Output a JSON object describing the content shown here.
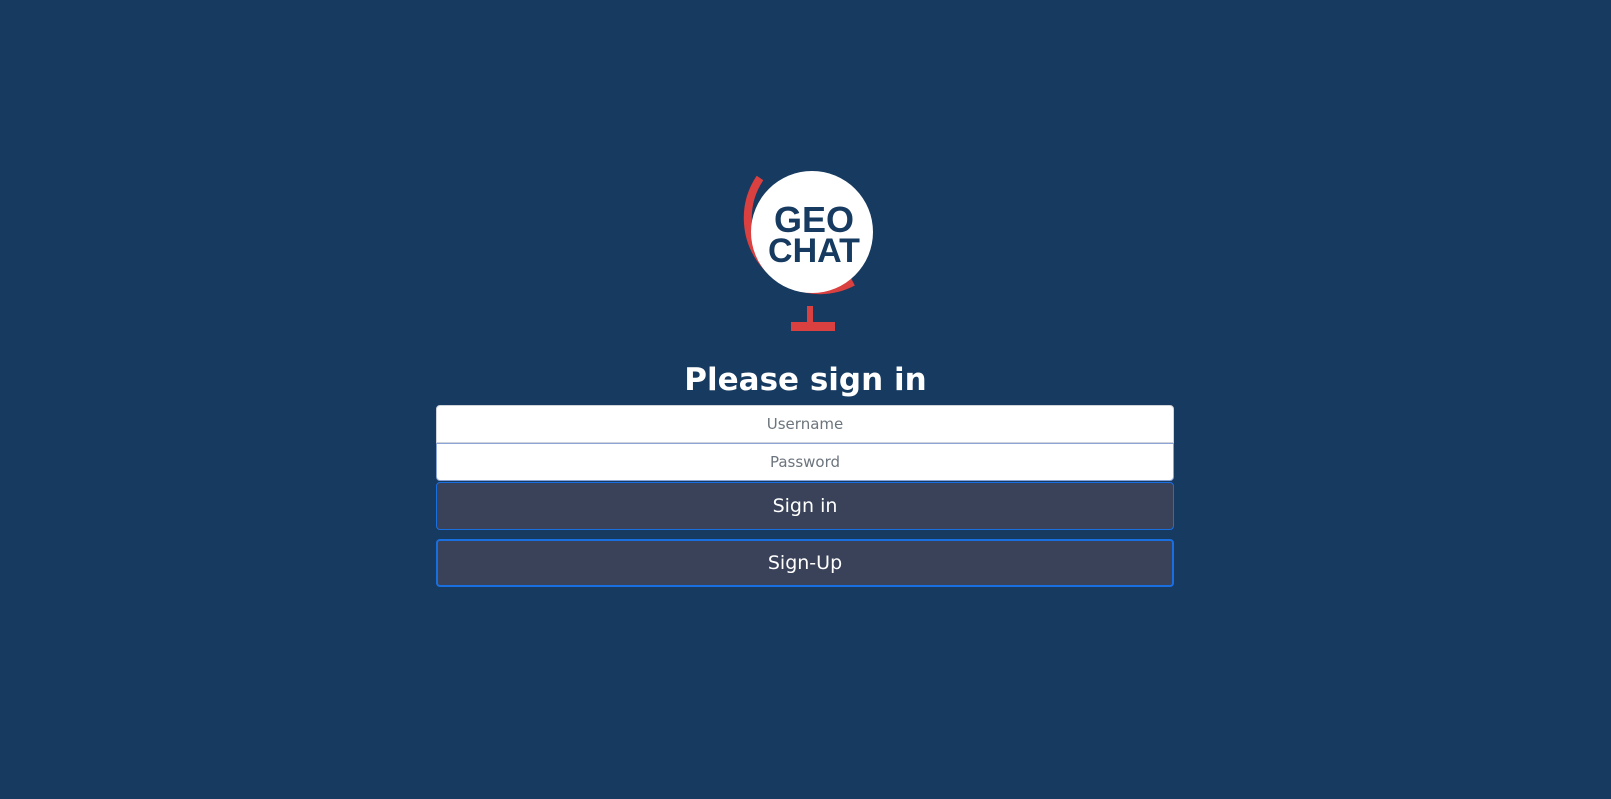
{
  "logo": {
    "line1": "GEO",
    "line2": "CHAT",
    "icon": "globe-icon",
    "colors": {
      "ring": "#d9403f",
      "circle": "#ffffff",
      "text": "#163a60"
    }
  },
  "login": {
    "title": "Please sign in",
    "username_placeholder": "Username",
    "password_placeholder": "Password",
    "signin_label": "Sign in",
    "signup_label": "Sign-Up"
  },
  "colors": {
    "background": "#163a60",
    "button": "#3a4259",
    "button_border": "#1a6fe0"
  }
}
